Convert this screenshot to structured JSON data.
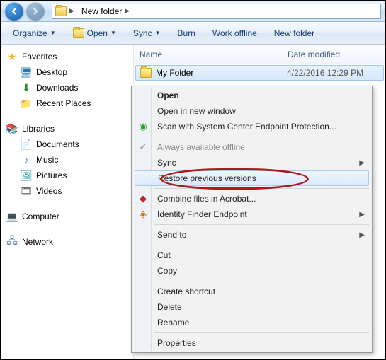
{
  "titlebar": {
    "location_folder": "New folder"
  },
  "toolbar": {
    "organize": "Organize",
    "open": "Open",
    "sync": "Sync",
    "burn": "Burn",
    "work_offline": "Work offline",
    "new_folder": "New folder"
  },
  "sidebar": {
    "favorites": {
      "label": "Favorites",
      "items": [
        "Desktop",
        "Downloads",
        "Recent Places"
      ]
    },
    "libraries": {
      "label": "Libraries",
      "items": [
        "Documents",
        "Music",
        "Pictures",
        "Videos"
      ]
    },
    "computer": {
      "label": "Computer"
    },
    "network": {
      "label": "Network"
    }
  },
  "columns": {
    "name": "Name",
    "date": "Date modified"
  },
  "rows": [
    {
      "name": "My Folder",
      "date": "4/22/2016 12:29 PM"
    }
  ],
  "context_menu": {
    "open": "Open",
    "open_new_window": "Open in new window",
    "scep": "Scan with System Center Endpoint Protection...",
    "always_offline": "Always available offline",
    "sync": "Sync",
    "restore": "Restore previous versions",
    "acrobat": "Combine files in Acrobat...",
    "identity": "Identity Finder Endpoint",
    "send_to": "Send to",
    "cut": "Cut",
    "copy": "Copy",
    "create_shortcut": "Create shortcut",
    "delete": "Delete",
    "rename": "Rename",
    "properties": "Properties"
  }
}
